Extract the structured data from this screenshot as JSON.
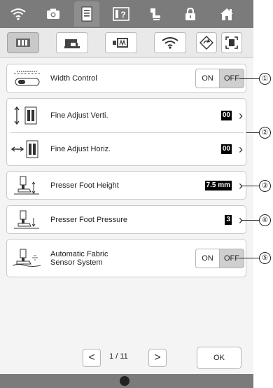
{
  "tabs": [
    {
      "name": "wifi-tab-icon"
    },
    {
      "name": "camera-tab-icon"
    },
    {
      "name": "document-tab-icon"
    },
    {
      "name": "help-tab-icon"
    },
    {
      "name": "sewing-tab-icon"
    },
    {
      "name": "lock-tab-icon"
    },
    {
      "name": "home-tab-icon"
    }
  ],
  "settings": {
    "width_control": {
      "label": "Width Control",
      "on": "ON",
      "off": "OFF"
    },
    "fine_adjust_verti": {
      "label": "Fine Adjust Verti.",
      "value": "00"
    },
    "fine_adjust_horiz": {
      "label": "Fine Adjust Horiz.",
      "value": "00"
    },
    "presser_foot_height": {
      "label": "Presser Foot Height",
      "value": "7.5 mm"
    },
    "presser_foot_pressure": {
      "label": "Presser Foot Pressure",
      "value": "3"
    },
    "auto_fabric_sensor": {
      "label": "Automatic Fabric\nSensor System",
      "on": "ON",
      "off": "OFF"
    }
  },
  "callouts": [
    "①",
    "②",
    "③",
    "④",
    "⑤"
  ],
  "pager": {
    "page": "1",
    "sep": "/",
    "total": "11",
    "prev": "<",
    "next": ">"
  },
  "ok": "OK"
}
